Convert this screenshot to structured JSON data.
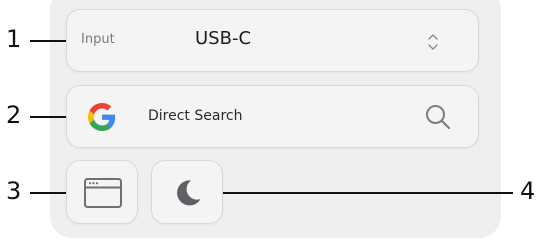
{
  "input_selector": {
    "label": "Input",
    "value": "USB-C",
    "icon": "chevron-up-down-icon"
  },
  "direct_search": {
    "label": "Direct Search",
    "provider_icon": "google-logo",
    "action_icon": "magnifier-icon"
  },
  "quick_buttons": [
    {
      "icon": "app-window-icon"
    },
    {
      "icon": "moon-icon"
    }
  ],
  "callouts": [
    "1",
    "2",
    "3",
    "4"
  ],
  "colors": {
    "panel_bg": "#efeff0",
    "card_bg": "#f4f4f5",
    "card_border": "#d9d9dc",
    "google_blue": "#4285F4",
    "google_red": "#EA4335",
    "google_yellow": "#FBBC05",
    "google_green": "#34A853"
  }
}
